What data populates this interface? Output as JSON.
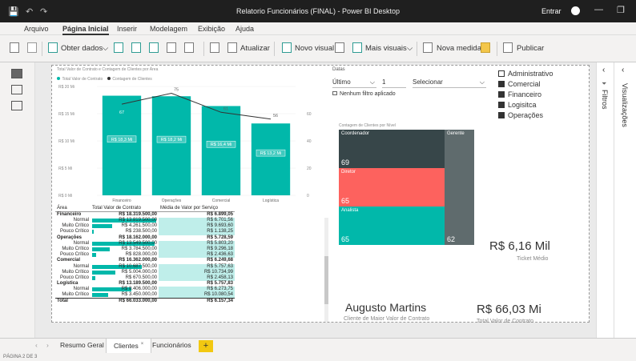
{
  "window": {
    "title": "Relatorio Funcionários (FINAL) - Power BI Desktop",
    "signin": "Entrar",
    "qa_save": "💾",
    "qa_undo": "↶",
    "qa_redo": "↷",
    "min": "—",
    "restore": "❐"
  },
  "menu": [
    "Arquivo",
    "Página Inicial",
    "Inserir",
    "Modelagem",
    "Exibição",
    "Ajuda"
  ],
  "ribbon": {
    "get_data": "Obter dados",
    "refresh": "Atualizar",
    "new_visual": "Novo visual",
    "more_visuals": "Mais visuais",
    "new_measure": "Nova medida",
    "publish": "Publicar",
    "dropdown_caret": "⌵"
  },
  "chart_data": {
    "type": "bar",
    "title": "Total Valor de Contrato e Contagem de Clientes por Área",
    "legend": [
      "Total Valor de Contrato",
      "Contagem de Clientes"
    ],
    "legend_colors": [
      "#01b8aa",
      "#333333"
    ],
    "categories": [
      "Financeiro",
      "Operações",
      "Comercial",
      "Logística"
    ],
    "series": [
      {
        "name": "Total Valor de Contrato",
        "values": [
          18.3,
          18.2,
          16.4,
          13.2
        ],
        "labels": [
          "R$ 18,3 Mi",
          "R$ 18,2 Mi",
          "R$ 16,4 Mi",
          "R$ 13,2 Mi"
        ],
        "color": "#01b8aa"
      },
      {
        "name": "Contagem de Clientes",
        "values": [
          67,
          75,
          61,
          56
        ],
        "color": "#333333"
      }
    ],
    "ylim": [
      0,
      20
    ],
    "ytick_labels": [
      "R$ 0 Mi",
      "R$ 5 Mi",
      "R$ 10 Mi",
      "R$ 15 Mi",
      "R$ 20 Mi"
    ],
    "y2lim": [
      0,
      80
    ],
    "y2tick_labels": [
      "0",
      "20",
      "40",
      "60"
    ]
  },
  "matrix": {
    "headers": [
      "Área",
      "Total Valor de Contrato",
      "Média de Valor por Serviço"
    ],
    "rows": [
      {
        "label": "Financeiro",
        "total": "R$ 18.319.500,00",
        "avg": "R$ 6.899,05",
        "level": 0
      },
      {
        "label": "Normal",
        "total": "R$ 13.819.500,00",
        "avg": "R$ 6.701,56",
        "level": 1,
        "frac": 1.0
      },
      {
        "label": "Muito Crítico",
        "total": "R$ 4.261.500,00",
        "avg": "R$ 9.693,60",
        "level": 1,
        "frac": 0.31
      },
      {
        "label": "Pouco Crítico",
        "total": "R$ 238.500,00",
        "avg": "R$ 1.138,25",
        "level": 1,
        "frac": 0.02
      },
      {
        "label": "Operações",
        "total": "R$ 18.162.000,00",
        "avg": "R$ 5.728,59",
        "level": 0
      },
      {
        "label": "Normal",
        "total": "R$ 13.549.500,00",
        "avg": "R$ 5.803,20",
        "level": 1,
        "frac": 0.98
      },
      {
        "label": "Muito Crítico",
        "total": "R$ 3.784.500,00",
        "avg": "R$ 9.296,18",
        "level": 1,
        "frac": 0.27
      },
      {
        "label": "Pouco Crítico",
        "total": "R$ 828.000,00",
        "avg": "R$ 2.436,63",
        "level": 1,
        "frac": 0.06
      },
      {
        "label": "Comercial",
        "total": "R$ 16.362.000,00",
        "avg": "R$ 6.249,68",
        "level": 0
      },
      {
        "label": "Normal",
        "total": "R$ 10.687.500,00",
        "avg": "R$ 5.757,63",
        "level": 1,
        "frac": 0.77
      },
      {
        "label": "Muito Crítico",
        "total": "R$ 5.004.000,00",
        "avg": "R$ 10.734,99",
        "level": 1,
        "frac": 0.36
      },
      {
        "label": "Pouco Crítico",
        "total": "R$ 670.500,00",
        "avg": "R$ 2.458,13",
        "level": 1,
        "frac": 0.05
      },
      {
        "label": "Logística",
        "total": "R$ 13.189.500,00",
        "avg": "R$ 5.757,83",
        "level": 0
      },
      {
        "label": "Normal",
        "total": "R$ 8.406.000,00",
        "avg": "R$ 6.273,75",
        "level": 1,
        "frac": 0.61
      },
      {
        "label": "Muito Crítico",
        "total": "R$ 3.450.000,00",
        "avg": "R$ 10.080,54",
        "level": 1,
        "frac": 0.25
      }
    ],
    "total": {
      "label": "Total",
      "total": "R$ 66.033.000,00",
      "avg": "R$ 6.157,34"
    }
  },
  "date_slicer": {
    "title": "Datas",
    "mode": "Último",
    "count": "1",
    "unit": "Selecionar",
    "caret": "⌵",
    "filter_note": "Nenhum filtro aplicado"
  },
  "area_slicer": [
    {
      "label": "Administrativo",
      "checked": false
    },
    {
      "label": "Comercial",
      "checked": true
    },
    {
      "label": "Financeiro",
      "checked": true
    },
    {
      "label": "Logisitca",
      "checked": true
    },
    {
      "label": "Operações",
      "checked": true
    }
  ],
  "treemap": {
    "title": "Contagem de Clientes por Nível",
    "cells": [
      {
        "label": "Coordenador",
        "value": "69",
        "color": "#374649"
      },
      {
        "label": "Diretor",
        "value": "65",
        "color": "#fd625e"
      },
      {
        "label": "Analista",
        "value": "65",
        "color": "#01b8aa"
      },
      {
        "label": "Gerente",
        "value": "62",
        "color": "#5f6b6d"
      }
    ]
  },
  "cards": {
    "ticket_value": "R$ 6,16 Mil",
    "ticket_label": "Ticket Médio",
    "client_value": "Augusto Martins",
    "client_label": "Cliente de Maior Valor de Contrato",
    "total_value": "R$ 66,03 Mi",
    "total_label": "Total Valor de Contrato"
  },
  "right_panel": {
    "filters": "Filtros",
    "visuals": "Visualizações"
  },
  "tabs": [
    "Resumo Geral",
    "Clientes",
    "Funcionários"
  ],
  "add_tab": "+",
  "tab_nav": [
    "‹",
    "›"
  ],
  "status": "PÁGINA 2 DE 3"
}
